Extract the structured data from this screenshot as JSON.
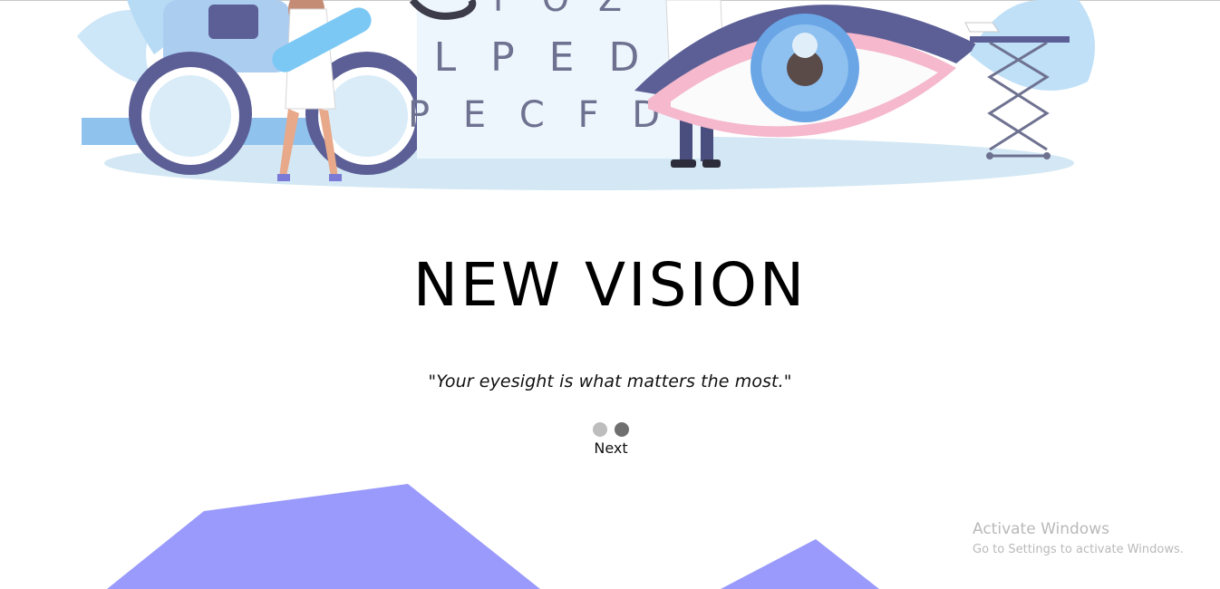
{
  "hero": {
    "eye_chart_rows": [
      "F O Z",
      "L P E D",
      "P E C F D"
    ]
  },
  "main": {
    "title": "NEW VISION",
    "tagline": "\"Your eyesight is what matters the most.\""
  },
  "carousel": {
    "slide_count": 2,
    "active_slide": 2,
    "next_label": "Next",
    "dot_colors": [
      "#bdbdbd",
      "#6f6f6f"
    ]
  },
  "watermark": {
    "title": "Activate Windows",
    "subtitle": "Go to Settings to activate Windows."
  },
  "colors": {
    "accent_purple": "#9a9afc",
    "hero_blue": "#a8d3f0",
    "hero_navy": "#5c5f96",
    "hero_pink": "#f5b8cc"
  }
}
